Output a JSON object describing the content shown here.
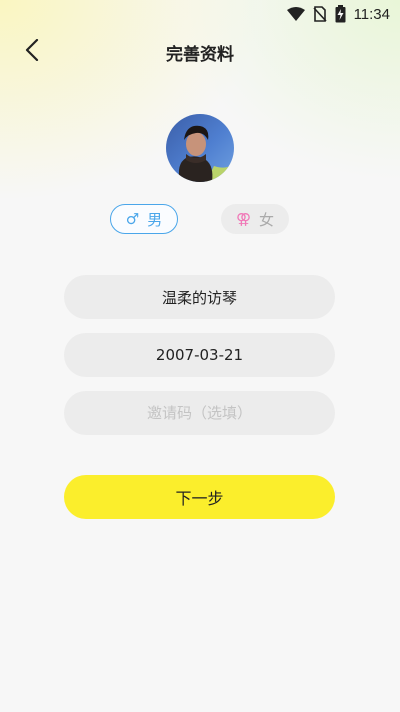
{
  "status_bar": {
    "time": "11:34"
  },
  "header": {
    "title": "完善资料"
  },
  "avatar": {
    "alt": "user avatar"
  },
  "gender": {
    "male": {
      "symbol": "♂",
      "label": "男"
    },
    "female": {
      "symbol": "⚢",
      "label": "女"
    },
    "selected": "male"
  },
  "form": {
    "nickname": {
      "value": "温柔的访琴"
    },
    "birthday": {
      "value": "2007-03-21"
    },
    "invite_code": {
      "value": "",
      "placeholder": "邀请码（选填）"
    }
  },
  "actions": {
    "next_label": "下一步"
  },
  "colors": {
    "accent_yellow": "#fbee2c",
    "male_blue": "#4aa6ea",
    "female_pink": "#f07ab8",
    "field_bg": "#ececec"
  },
  "icons": {
    "back": "chevron-left-icon",
    "wifi": "wifi-icon",
    "no_sim": "no-sim-icon",
    "battery": "battery-charging-icon"
  }
}
